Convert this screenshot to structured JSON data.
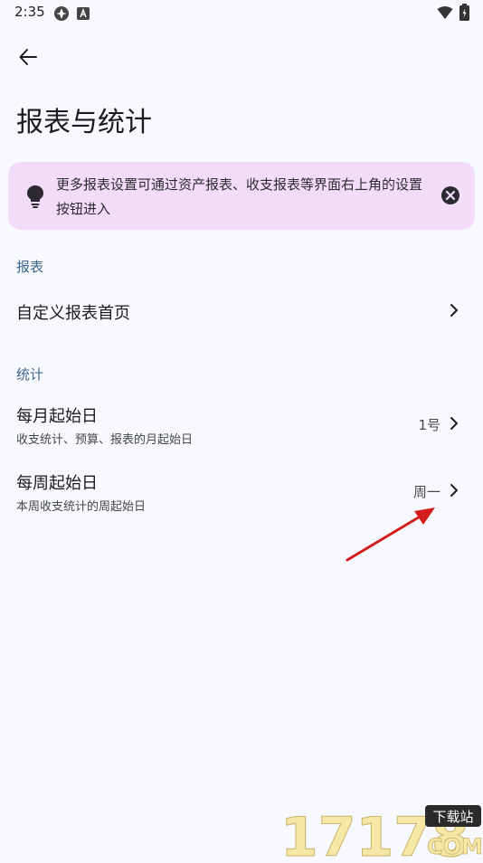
{
  "status": {
    "time": "2:35"
  },
  "header": {
    "title": "报表与统计"
  },
  "tip": {
    "text": "更多报表设置可通过资产报表、收支报表等界面右上角的设置按钮进入"
  },
  "sections": {
    "report": {
      "header": "报表",
      "items": [
        {
          "title": "自定义报表首页"
        }
      ]
    },
    "stats": {
      "header": "统计",
      "items": [
        {
          "title": "每月起始日",
          "subtitle": "收支统计、预算、报表的月起始日",
          "value": "1号"
        },
        {
          "title": "每周起始日",
          "subtitle": "本周收支统计的周起始日",
          "value": "周一"
        }
      ]
    }
  },
  "watermark": {
    "digits": "17178",
    "badge": "下载站",
    "suffix": "COM"
  },
  "colors": {
    "accent": "#3b6690",
    "tip_bg": "#f2dcf9",
    "annotation_arrow": "#d41c1c"
  }
}
